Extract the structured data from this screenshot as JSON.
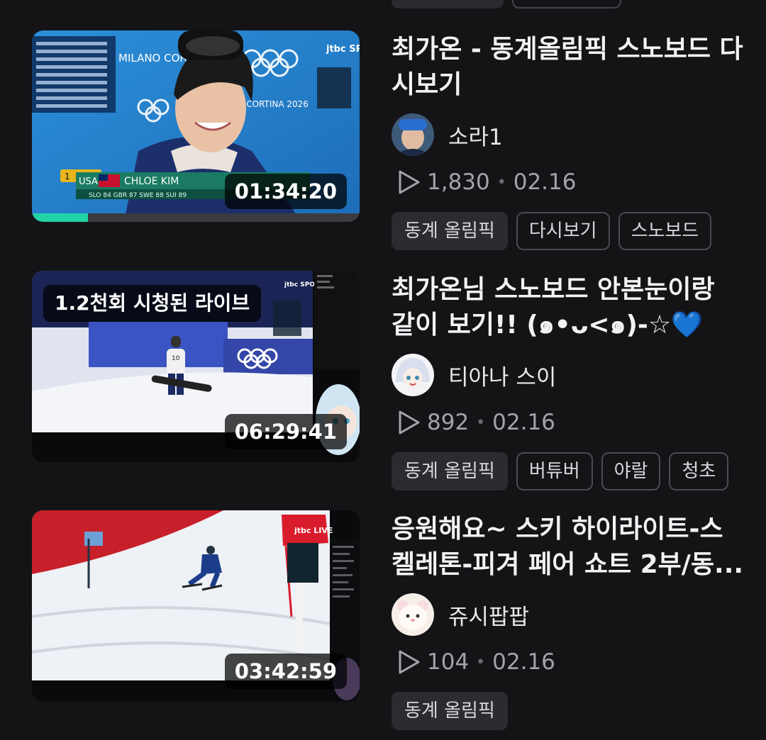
{
  "videos": [
    {
      "title": "최가온 - 동계올림픽 스노보드 다시보기",
      "duration": "01:34:20",
      "channel": "소라1",
      "views": "1,830",
      "date": "02.16",
      "progress_fraction": 0.17,
      "tags": [
        "동계 올림픽",
        "다시보기",
        "스노보드"
      ],
      "overlay": {
        "event": "MILANO CORTINA 2026",
        "event2": "NO CORTINA 2026",
        "broadcaster": "jtbc SPORTS LIVE",
        "nation": "USA",
        "athlete": "CHLOE KIM",
        "rank": "1",
        "scoreboard": "SLO 84 GBR 87 SWE 88 SUI 89"
      }
    },
    {
      "title": "최가온님 스노보드 안본눈이랑 같이 보기!! (๑•ᴗ<๑)-☆💙",
      "duration": "06:29:41",
      "channel": "티아나 스이",
      "views": "892",
      "date": "02.16",
      "live_badge": "1.2천회 시청된 라이브",
      "tags": [
        "동계 올림픽",
        "버튜버",
        "야랄",
        "청초"
      ],
      "overlay": {
        "broadcaster": "jtbc SPORTS LIVE",
        "bib": "10"
      }
    },
    {
      "title": "응원해요~ 스키 하이라이트-스켈레톤-피겨 페어 쇼트 2부/동...",
      "duration": "03:42:59",
      "channel": "쥬시팝팝",
      "views": "104",
      "date": "02.16",
      "tags": [
        "동계 올림픽"
      ],
      "overlay": {
        "broadcaster": "jtbc LIVE"
      }
    }
  ],
  "colors": {
    "background": "#141417",
    "progress": "#22d3a6",
    "tag_filled": "#2b2b30",
    "tag_border": "#4a4a50",
    "heart": "#2f8cf0"
  },
  "icons": {
    "views": "play-outline-icon"
  }
}
